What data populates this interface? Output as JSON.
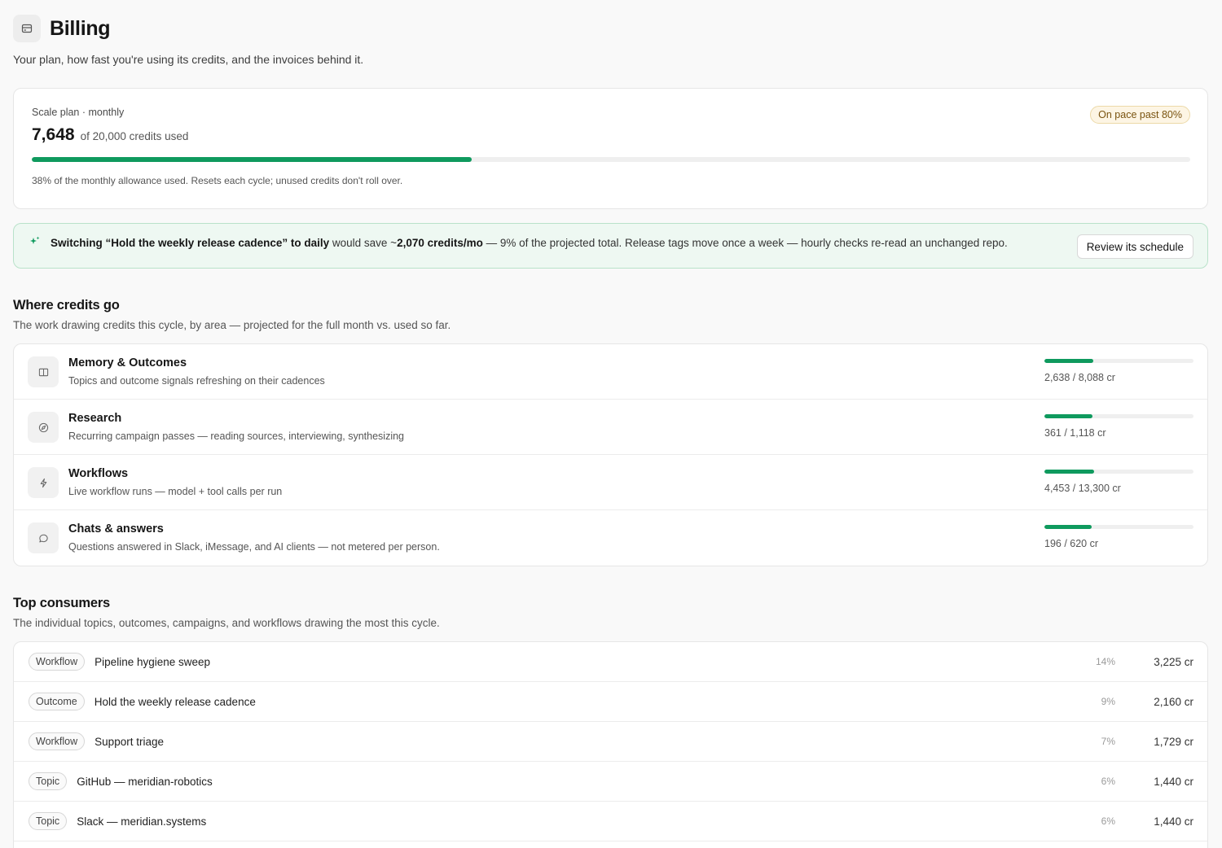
{
  "page": {
    "title": "Billing",
    "subtitle": "Your plan, how fast you're using its credits, and the invoices behind it.",
    "icon": "credit-card-icon"
  },
  "plan": {
    "label": "Scale plan · monthly",
    "used": "7,648",
    "of_text": "of 20,000 credits used",
    "progress_fraction": 0.38,
    "badge": "On pace past 80%",
    "note": "38% of the monthly allowance used. Resets each cycle; unused credits don't roll over."
  },
  "suggestion": {
    "icon": "sparkle-icon",
    "lead": "Switching “Hold the weekly release cadence” to daily",
    "mid": " would save ~",
    "savings": "2,070 credits/mo",
    "tail": " — 9% of the projected total. Release tags move once a week — hourly checks re-read an unchanged repo.",
    "button": "Review its schedule"
  },
  "areas": {
    "title": "Where credits go",
    "subtitle": "The work drawing credits this cycle, by area — projected for the full month vs. used so far.",
    "items": [
      {
        "name": "Memory & Outcomes",
        "desc": "Topics and outcome signals refreshing on their cadences",
        "value": "2,638 / 8,088 cr",
        "fill": 0.326,
        "icon": "book-icon"
      },
      {
        "name": "Research",
        "desc": "Recurring campaign passes — reading sources, interviewing, synthesizing",
        "value": "361 / 1,118 cr",
        "fill": 0.323,
        "icon": "compass-icon"
      },
      {
        "name": "Workflows",
        "desc": "Live workflow runs — model + tool calls per run",
        "value": "4,453 / 13,300 cr",
        "fill": 0.335,
        "icon": "bolt-icon"
      },
      {
        "name": "Chats & answers",
        "desc": "Questions answered in Slack, iMessage, and AI clients — not metered per person.",
        "value": "196 / 620 cr",
        "fill": 0.316,
        "icon": "chat-bubble-icon"
      }
    ]
  },
  "consumers": {
    "title": "Top consumers",
    "subtitle": "The individual topics, outcomes, campaigns, and workflows drawing the most this cycle.",
    "rows": [
      {
        "type": "Workflow",
        "name": "Pipeline hygiene sweep",
        "pct": "14%",
        "credits": "3,225 cr"
      },
      {
        "type": "Outcome",
        "name": "Hold the weekly release cadence",
        "pct": "9%",
        "credits": "2,160 cr"
      },
      {
        "type": "Workflow",
        "name": "Support triage",
        "pct": "7%",
        "credits": "1,729 cr"
      },
      {
        "type": "Topic",
        "name": "GitHub — meridian-robotics",
        "pct": "6%",
        "credits": "1,440 cr"
      },
      {
        "type": "Topic",
        "name": "Slack — meridian.systems",
        "pct": "6%",
        "credits": "1,440 cr"
      }
    ]
  },
  "colors": {
    "accent_green": "#0f9a5e",
    "warning_badge_bg": "#fdf5e4",
    "banner_bg": "#eef8f2"
  }
}
